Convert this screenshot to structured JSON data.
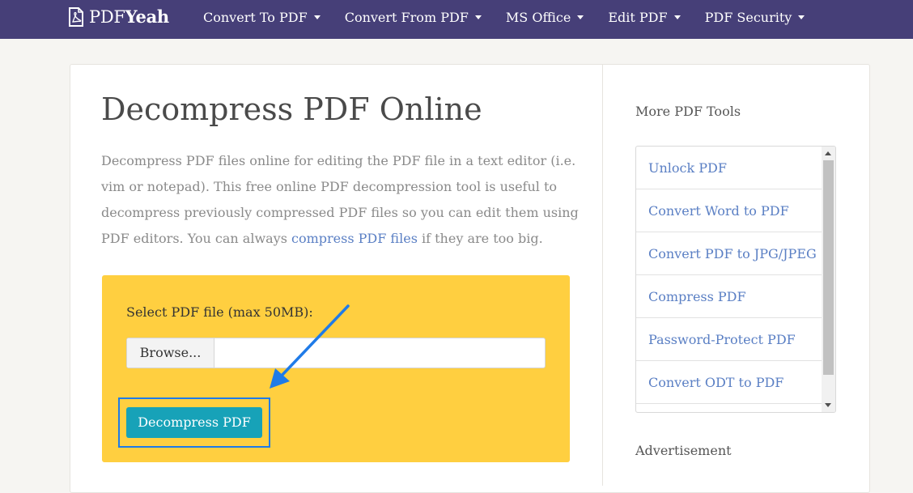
{
  "brand": {
    "name_regular": "PDF",
    "name_bold": "Yeah",
    "logo_icon": "pdf-file-icon"
  },
  "nav": {
    "items": [
      {
        "label": "Convert To PDF"
      },
      {
        "label": "Convert From PDF"
      },
      {
        "label": "MS Office"
      },
      {
        "label": "Edit PDF"
      },
      {
        "label": "PDF Security"
      }
    ]
  },
  "main": {
    "title": "Decompress PDF Online",
    "intro_before_link": "Decompress PDF files online for editing the PDF file in a text editor (i.e. vim or notepad). This free online PDF decompression tool is useful to decompress previously compressed PDF files so you can edit them using PDF editors. You can always ",
    "intro_link": "compress PDF files",
    "intro_after_link": " if they are too big.",
    "upload": {
      "label": "Select PDF file (max 50MB):",
      "browse_label": "Browse...",
      "submit_label": "Decompress PDF"
    }
  },
  "sidebar": {
    "title": "More PDF Tools",
    "tools": [
      {
        "label": "Unlock PDF"
      },
      {
        "label": "Convert Word to PDF"
      },
      {
        "label": "Convert PDF to JPG/JPEG"
      },
      {
        "label": "Compress PDF"
      },
      {
        "label": "Password-Protect PDF"
      },
      {
        "label": "Convert ODT to PDF"
      }
    ],
    "ad_label": "Advertisement"
  },
  "colors": {
    "navbar": "#463f78",
    "upload_box": "#ffcf40",
    "primary_button": "#17a2b8",
    "link": "#5a7fc4",
    "annotation": "#1f7be8"
  }
}
